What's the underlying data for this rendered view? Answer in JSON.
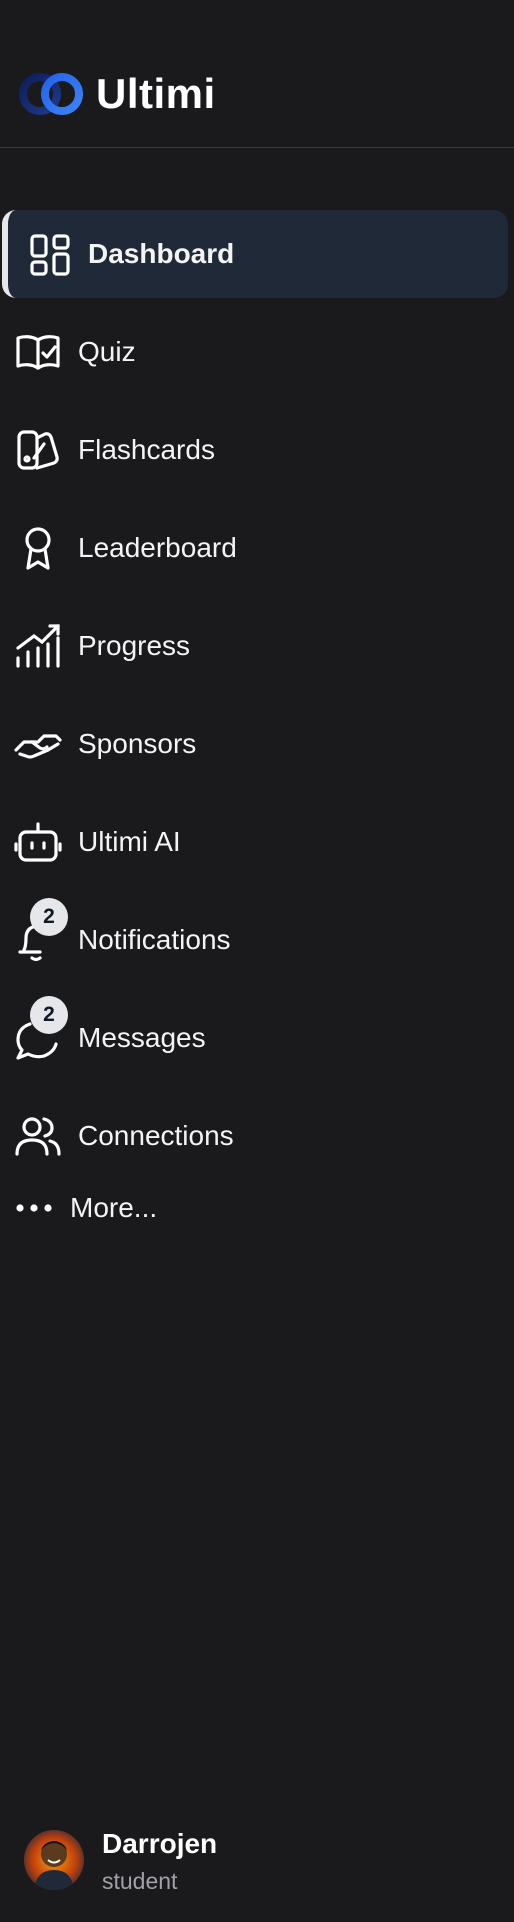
{
  "brand": {
    "name": "Ultimi",
    "logo_icon": "infinity-rings-icon",
    "logo_colors": [
      "#1e3a8a",
      "#2f6fe0"
    ]
  },
  "nav": {
    "items": [
      {
        "label": "Dashboard",
        "icon": "dashboard-grid-icon",
        "active": true
      },
      {
        "label": "Quiz",
        "icon": "book-check-icon"
      },
      {
        "label": "Flashcards",
        "icon": "cards-icon"
      },
      {
        "label": "Leaderboard",
        "icon": "ribbon-award-icon"
      },
      {
        "label": "Progress",
        "icon": "chart-trend-icon"
      },
      {
        "label": "Sponsors",
        "icon": "handshake-icon"
      },
      {
        "label": "Ultimi AI",
        "icon": "robot-icon"
      },
      {
        "label": "Notifications",
        "icon": "bell-icon",
        "badge": "2"
      },
      {
        "label": "Messages",
        "icon": "chat-bubble-icon",
        "badge": "2"
      },
      {
        "label": "Connections",
        "icon": "users-icon"
      }
    ],
    "more_label": "More...",
    "more_icon": "ellipsis-icon"
  },
  "user": {
    "name": "Darrojen",
    "role": "student",
    "avatar_icon": "avatar-icon"
  },
  "colors": {
    "background": "#1a1a1c",
    "active_bg": "#1f2937",
    "badge_bg": "#e5e7eb"
  }
}
